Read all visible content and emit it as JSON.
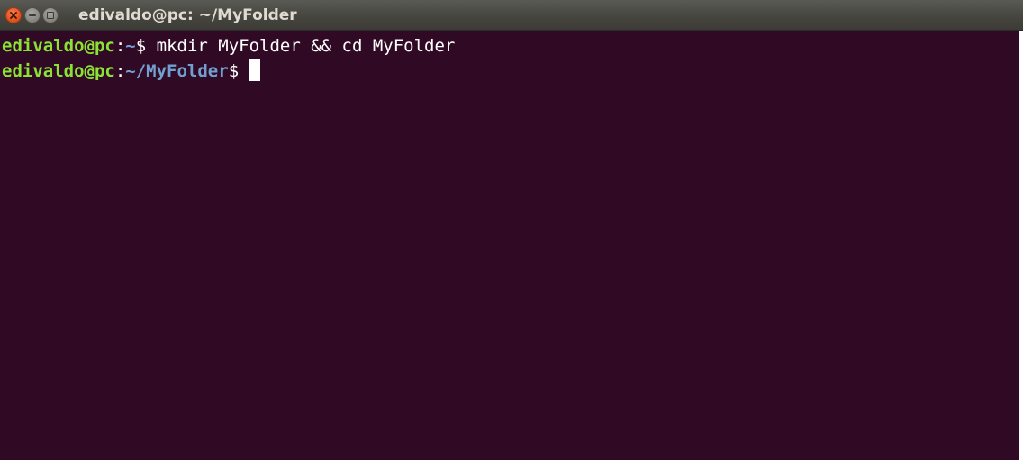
{
  "window": {
    "title": "edivaldo@pc: ~/MyFolder",
    "controls": {
      "close_icon": "close-icon",
      "minimize_icon": "minimize-icon",
      "maximize_icon": "maximize-icon"
    }
  },
  "terminal": {
    "background": "#300a24",
    "lines": [
      {
        "user_host": "edivaldo@pc",
        "colon": ":",
        "path": "~",
        "prompt": "$ ",
        "command": "mkdir MyFolder && cd MyFolder"
      },
      {
        "user_host": "edivaldo@pc",
        "colon": ":",
        "path": "~/MyFolder",
        "prompt": "$ ",
        "command": ""
      }
    ]
  },
  "colors": {
    "prompt_user": "#8ae234",
    "prompt_path": "#729fcf",
    "text": "#ffffff",
    "close_button": "#e2541f"
  }
}
